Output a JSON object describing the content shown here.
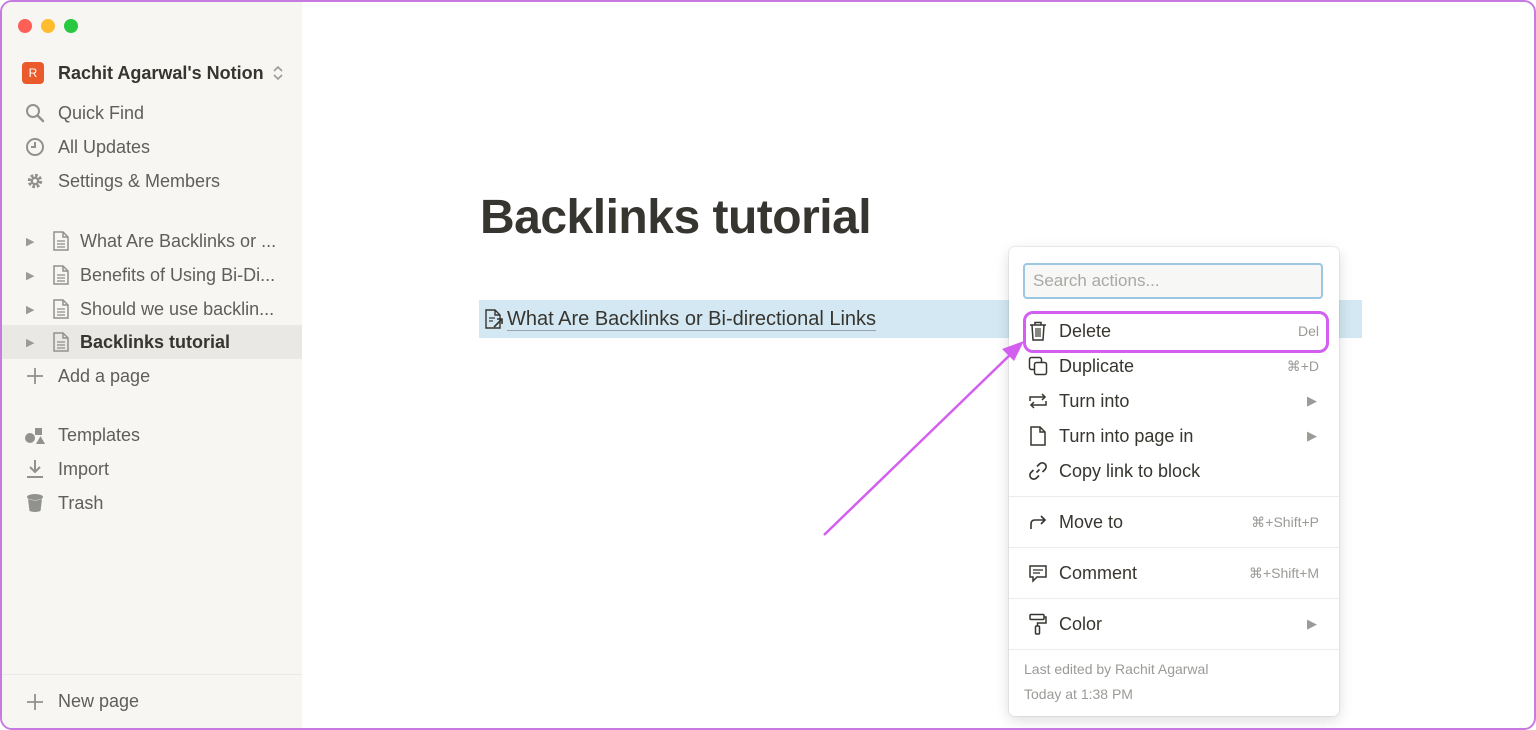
{
  "window": {
    "traffic_lights": [
      "close",
      "minimize",
      "zoom"
    ]
  },
  "sidebar": {
    "workspace": {
      "avatar": "R",
      "name": "Rachit Agarwal's Notion",
      "avatar_color": "#ea5a2a"
    },
    "nav": [
      {
        "label": "Quick Find",
        "icon": "search-icon"
      },
      {
        "label": "All Updates",
        "icon": "clock-icon"
      },
      {
        "label": "Settings & Members",
        "icon": "gear-icon"
      }
    ],
    "pages": [
      {
        "label": "What Are Backlinks or ...",
        "active": false
      },
      {
        "label": "Benefits of Using Bi-Di...",
        "active": false
      },
      {
        "label": "Should we use backlin...",
        "active": false
      },
      {
        "label": "Backlinks tutorial",
        "active": true
      }
    ],
    "add_page": "Add a page",
    "bottom": [
      {
        "label": "Templates",
        "icon": "templates-icon"
      },
      {
        "label": "Import",
        "icon": "download-icon"
      },
      {
        "label": "Trash",
        "icon": "trash-icon"
      }
    ],
    "new_page": "New page"
  },
  "main": {
    "title": "Backlinks tutorial",
    "link_block": "What Are Backlinks or Bi-directional Links"
  },
  "menu": {
    "search_placeholder": "Search actions...",
    "items": [
      {
        "label": "Delete",
        "shortcut": "Del",
        "icon": "trash-icon"
      },
      {
        "label": "Duplicate",
        "shortcut": "⌘+D",
        "icon": "duplicate-icon"
      },
      {
        "label": "Turn into",
        "submenu": true,
        "icon": "turn-into-icon"
      },
      {
        "label": "Turn into page in",
        "submenu": true,
        "icon": "page-icon"
      },
      {
        "label": "Copy link to block",
        "icon": "link-icon"
      },
      {
        "label": "Move to",
        "shortcut": "⌘+Shift+P",
        "icon": "move-to-icon"
      },
      {
        "label": "Comment",
        "shortcut": "⌘+Shift+M",
        "icon": "comment-icon"
      },
      {
        "label": "Color",
        "submenu": true,
        "icon": "paint-roller-icon"
      }
    ],
    "submenu_arrow": "▶",
    "last_edited_by": "Last edited by Rachit Agarwal",
    "last_edited_time": "Today at 1:38 PM"
  },
  "annotation": {
    "color": "#d35ff0"
  }
}
